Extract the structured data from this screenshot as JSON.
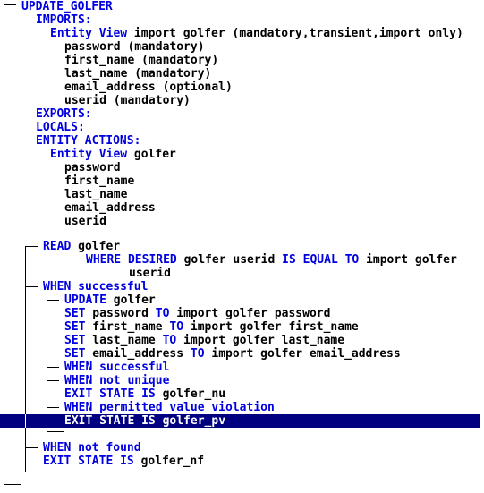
{
  "action_block": {
    "name": "UPDATE_GOLFER",
    "imports_label": "IMPORTS:",
    "import_view": {
      "kw": "Entity View",
      "text": " import golfer (mandatory,transient,import only)",
      "attributes": [
        "password (mandatory)",
        "first_name (mandatory)",
        "last_name (mandatory)",
        "email_address (optional)",
        "userid (mandatory)"
      ]
    },
    "exports_label": "EXPORTS:",
    "locals_label": "LOCALS:",
    "entity_actions_label": "ENTITY ACTIONS:",
    "entity_view": {
      "kw": "Entity View",
      "text": " golfer",
      "attributes": [
        "password",
        "first_name",
        "last_name",
        "email_address",
        "userid"
      ]
    }
  },
  "statements": {
    "read": {
      "kw": "READ",
      "text": " golfer"
    },
    "where": {
      "kw1": "WHERE DESIRED",
      "t1": " golfer userid ",
      "kw2": "IS EQUAL TO",
      "t2": " import golfer"
    },
    "where_cont": "userid",
    "when_successful": {
      "kw": "WHEN successful"
    },
    "update": {
      "kw": "UPDATE",
      "text": " golfer"
    },
    "sets": [
      {
        "kw": "SET",
        "a": " password ",
        "kw2": "TO",
        "b": " import golfer password"
      },
      {
        "kw": "SET",
        "a": " first_name ",
        "kw2": "TO",
        "b": " import golfer first_name"
      },
      {
        "kw": "SET",
        "a": " last_name ",
        "kw2": "TO",
        "b": " import golfer last_name"
      },
      {
        "kw": "SET",
        "a": " email_address ",
        "kw2": "TO",
        "b": " import golfer email_address"
      }
    ],
    "inner_when_successful": "WHEN successful",
    "when_not_unique": "WHEN not unique",
    "exit_nu": {
      "kw": "EXIT STATE IS",
      "text": " golfer_nu"
    },
    "when_pvv": "WHEN permitted value violation",
    "exit_pv": {
      "kw": "EXIT STATE IS",
      "text": " golfer_pv",
      "selected": true
    },
    "when_not_found": "WHEN not found",
    "exit_nf": {
      "kw": "EXIT STATE IS",
      "text": " golfer_nf"
    }
  },
  "colors": {
    "keyword": "#0000e0",
    "text": "#000000",
    "selection": "#000080"
  }
}
